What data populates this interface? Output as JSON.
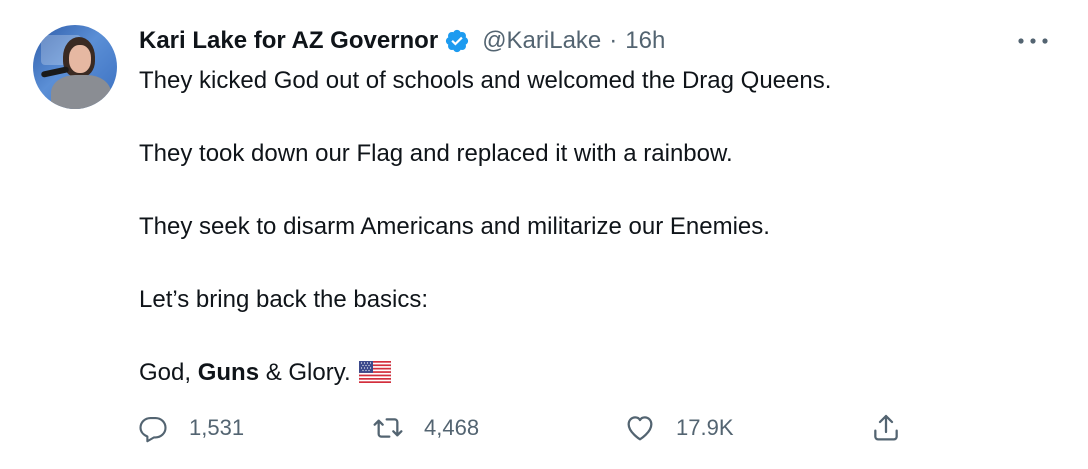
{
  "author": {
    "name": "Kari Lake for AZ Governor",
    "handle": "@KariLake",
    "separator": "·",
    "time": "16h",
    "verified": true
  },
  "tweet": {
    "lines": [
      "They kicked God out of schools and welcomed the Drag Queens.",
      "They took down our Flag and replaced it with a rainbow.",
      "They seek to disarm Americans and militarize our Enemies.",
      "Let’s bring back the basics:"
    ],
    "last_line": {
      "part1": "God, ",
      "bold": "Guns",
      "part2": " & Glory.",
      "emoji": "us-flag-emoji"
    }
  },
  "actions": {
    "reply": {
      "icon": "reply-icon",
      "count": "1,531"
    },
    "retweet": {
      "icon": "retweet-icon",
      "count": "4,468"
    },
    "like": {
      "icon": "heart-icon",
      "count": "17.9K"
    },
    "share": {
      "icon": "share-icon"
    }
  },
  "colors": {
    "text": "#0f1419",
    "secondary": "#536471",
    "verified": "#1d9bf0"
  }
}
